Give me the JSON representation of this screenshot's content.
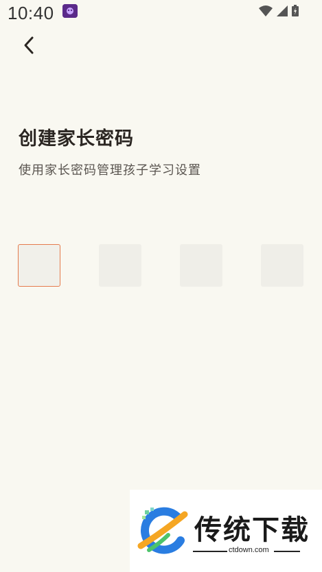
{
  "status_bar": {
    "time": "10:40",
    "icons": [
      "app-notification-icon",
      "wifi-icon",
      "signal-icon",
      "battery-icon"
    ]
  },
  "header": {
    "back_icon": "chevron-left-icon"
  },
  "main": {
    "title": "创建家长密码",
    "subtitle": "使用家长密码管理孩子学习设置",
    "pin": {
      "length": 4,
      "active_index": 0,
      "digits": [
        "",
        "",
        "",
        ""
      ]
    }
  },
  "watermark": {
    "brand_text": "传统下载",
    "domain": "ctdown.com"
  },
  "colors": {
    "background": "#f9f8f1",
    "pin_box": "#efeee8",
    "pin_active_border": "#e57a4c",
    "title": "#2b2622",
    "subtitle": "#5a5550"
  }
}
